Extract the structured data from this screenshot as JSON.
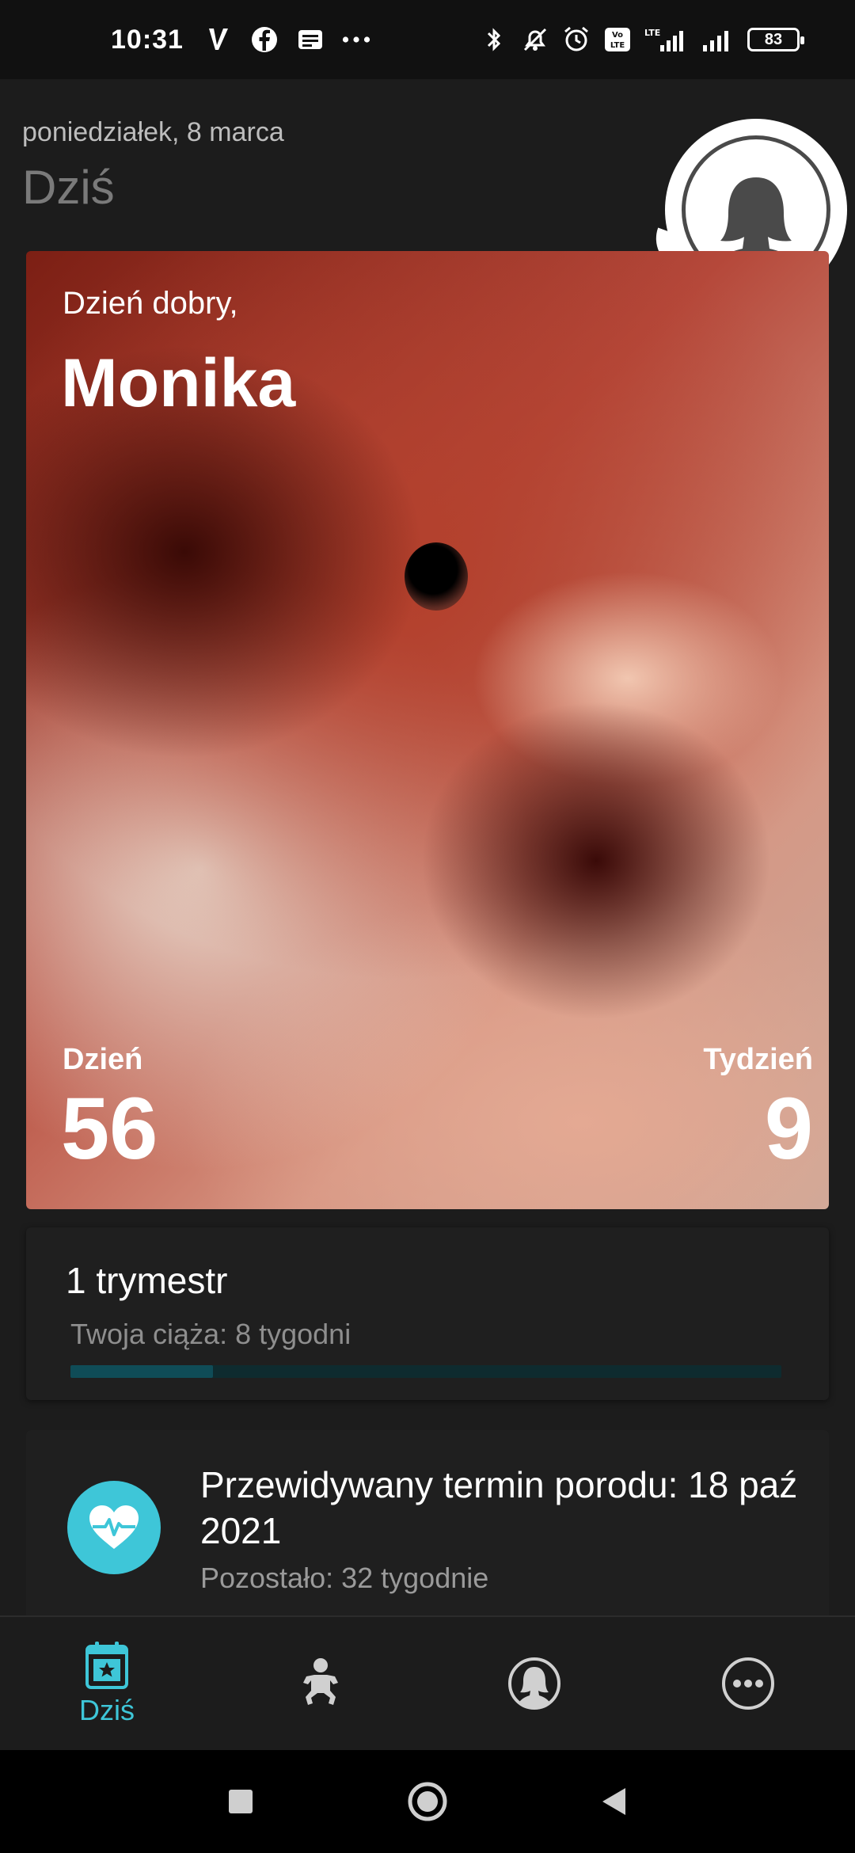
{
  "status_bar": {
    "time": "10:31",
    "left_icons": [
      "v-app-icon",
      "facebook-icon",
      "news-icon",
      "more-dots-icon"
    ],
    "right_icons": [
      "bluetooth-icon",
      "mute-icon",
      "alarm-icon",
      "volte-icon",
      "lte-signal-icon",
      "signal-icon"
    ],
    "battery": "83"
  },
  "header": {
    "date": "poniedziałek, 8 marca",
    "title": "Dziś"
  },
  "hero": {
    "greeting": "Dzień dobry,",
    "name": "Monika",
    "day_label": "Dzień",
    "day_value": "56",
    "week_label": "Tydzień",
    "week_value": "9"
  },
  "trimester": {
    "title": "1 trymestr",
    "subtitle": "Twoja ciąża: 8 tygodni",
    "progress_fraction": 0.2
  },
  "due": {
    "title": "Przewidywany termin porodu: 18 paź 2021",
    "remaining": "Pozostało: 32 tygodnie"
  },
  "bottom_nav": {
    "items": [
      {
        "icon": "calendar-icon",
        "label": "Dziś",
        "active": true
      },
      {
        "icon": "baby-icon",
        "label": "",
        "active": false
      },
      {
        "icon": "mother-icon",
        "label": "",
        "active": false
      },
      {
        "icon": "more-icon",
        "label": "",
        "active": false
      }
    ]
  },
  "colors": {
    "accent": "#3ec6d8",
    "background": "#1c1c1c",
    "card": "#1f1f1f",
    "progress_track": "#0e2b2f",
    "progress_fill": "#0f4c57"
  }
}
